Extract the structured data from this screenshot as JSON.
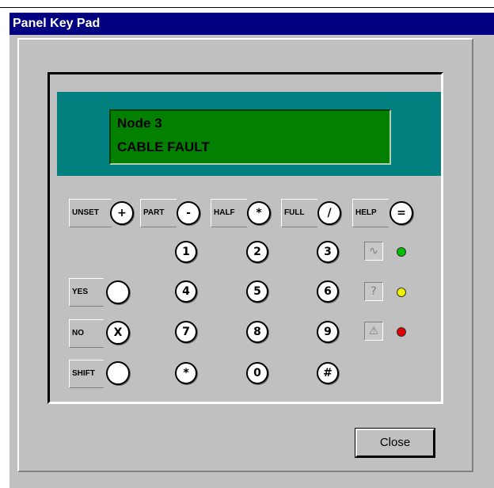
{
  "window": {
    "title": "Panel Key Pad"
  },
  "display": {
    "line1": "Node 3",
    "line2": "CABLE FAULT"
  },
  "function_keys": [
    {
      "label": "UNSET",
      "key": "+"
    },
    {
      "label": "PART",
      "key": "-"
    },
    {
      "label": "HALF",
      "key": "*"
    },
    {
      "label": "FULL",
      "key": "/"
    },
    {
      "label": "HELP",
      "key": "="
    }
  ],
  "side_keys": [
    {
      "label": "YES",
      "key": ""
    },
    {
      "label": "NO",
      "key": "X"
    },
    {
      "label": "SHIFT",
      "key": ""
    }
  ],
  "number_keys": [
    "1",
    "2",
    "3",
    "4",
    "5",
    "6",
    "7",
    "8",
    "9",
    "*",
    "0",
    "#"
  ],
  "indicators": [
    {
      "icon": "sine-wave-icon",
      "symbol": "∿",
      "color": "#00c000"
    },
    {
      "icon": "question-icon",
      "symbol": "?",
      "color": "#f0f000"
    },
    {
      "icon": "warning-icon",
      "symbol": "⚠",
      "color": "#e00000"
    }
  ],
  "buttons": {
    "close": "Close"
  }
}
